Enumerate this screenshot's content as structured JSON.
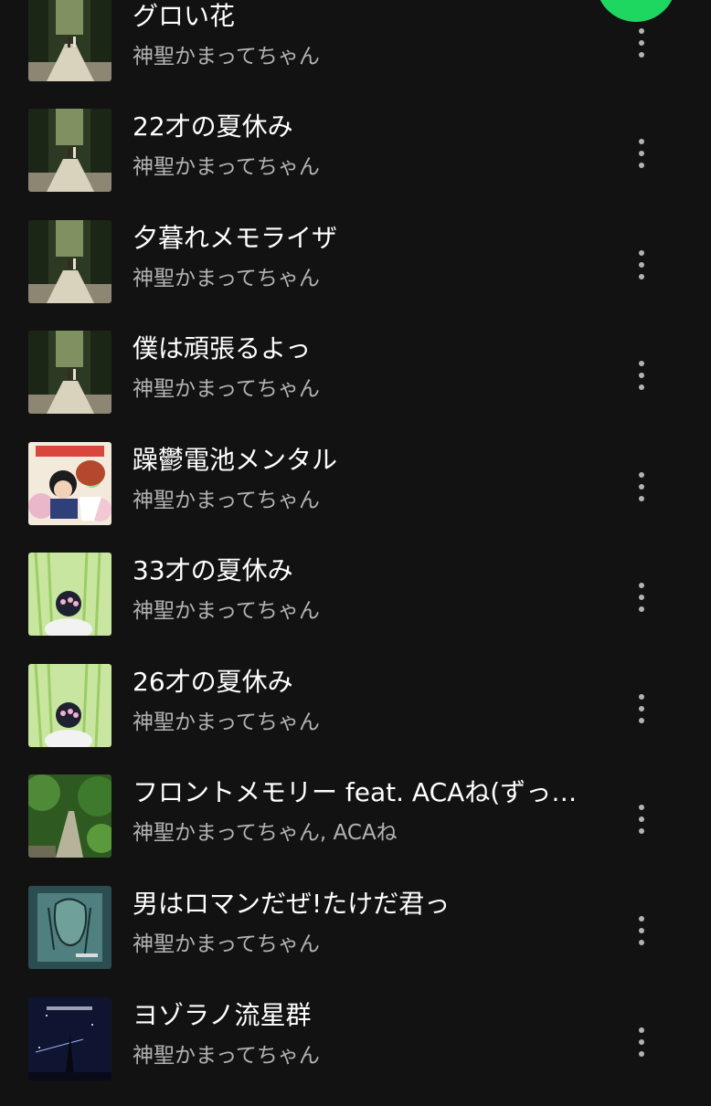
{
  "accent_color": "#1ed760",
  "more_icon": "more-vertical-icon",
  "tracks": [
    {
      "title": "グロい花",
      "artist": "神聖かまってちゃん",
      "art": "forest-path-photo"
    },
    {
      "title": "22才の夏休み",
      "artist": "神聖かまってちゃん",
      "art": "forest-path-photo"
    },
    {
      "title": "夕暮れメモライザ",
      "artist": "神聖かまってちゃん",
      "art": "forest-path-photo"
    },
    {
      "title": "僕は頑張るよっ",
      "artist": "神聖かまってちゃん",
      "art": "forest-path-photo"
    },
    {
      "title": "躁鬱電池メンタル",
      "artist": "神聖かまってちゃん",
      "art": "anime-flowers-art"
    },
    {
      "title": "33才の夏休み",
      "artist": "神聖かまってちゃん",
      "art": "bamboo-figure-art"
    },
    {
      "title": "26才の夏休み",
      "artist": "神聖かまってちゃん",
      "art": "bamboo-figure-art"
    },
    {
      "title": "フロントメモリー feat. ACAね(ずっ…",
      "artist": "神聖かまってちゃん, ACAね",
      "art": "green-path-photo"
    },
    {
      "title": "男はロマンだぜ!たけだ君っ",
      "artist": "神聖かまってちゃん",
      "art": "sketch-portrait-art"
    },
    {
      "title": "ヨゾラノ流星群",
      "artist": "神聖かまってちゃん",
      "art": "night-sky-art"
    }
  ]
}
